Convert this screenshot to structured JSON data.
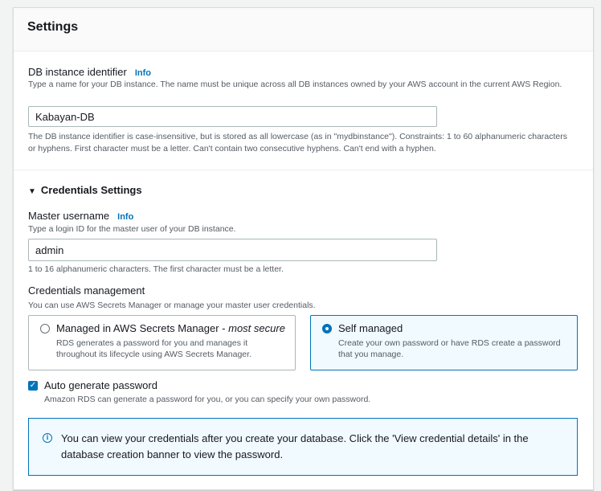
{
  "title": "Settings",
  "db_identifier": {
    "label": "DB instance identifier",
    "info": "Info",
    "description": "Type a name for your DB instance. The name must be unique across all DB instances owned by your AWS account in the current AWS Region.",
    "value": "Kabayan-DB",
    "constraints": "The DB instance identifier is case-insensitive, but is stored as all lowercase (as in \"mydbinstance\"). Constraints: 1 to 60 alphanumeric characters or hyphens. First character must be a letter. Can't contain two consecutive hyphens. Can't end with a hyphen."
  },
  "credentials": {
    "section_label": "Credentials Settings",
    "username": {
      "label": "Master username",
      "info": "Info",
      "description": "Type a login ID for the master user of your DB instance.",
      "value": "admin",
      "hint": "1 to 16 alphanumeric characters. The first character must be a letter."
    },
    "management": {
      "label": "Credentials management",
      "description": "You can use AWS Secrets Manager or manage your master user credentials.",
      "options": [
        {
          "title": "Managed in AWS Secrets Manager - ",
          "title_em": "most secure",
          "description": "RDS generates a password for you and manages it throughout its lifecycle using AWS Secrets Manager.",
          "selected": false
        },
        {
          "title": "Self managed",
          "title_em": "",
          "description": "Create your own password or have RDS create a password that you manage.",
          "selected": true
        }
      ]
    },
    "auto_generate": {
      "label": "Auto generate password",
      "description": "Amazon RDS can generate a password for you, or you can specify your own password.",
      "checked": true
    },
    "alert": {
      "icon": "info-icon",
      "text": "You can view your credentials after you create your database. Click the 'View credential details' in the database creation banner to view the password."
    }
  },
  "colors": {
    "accent": "#0073bb",
    "alert_bg": "#f1faff"
  }
}
